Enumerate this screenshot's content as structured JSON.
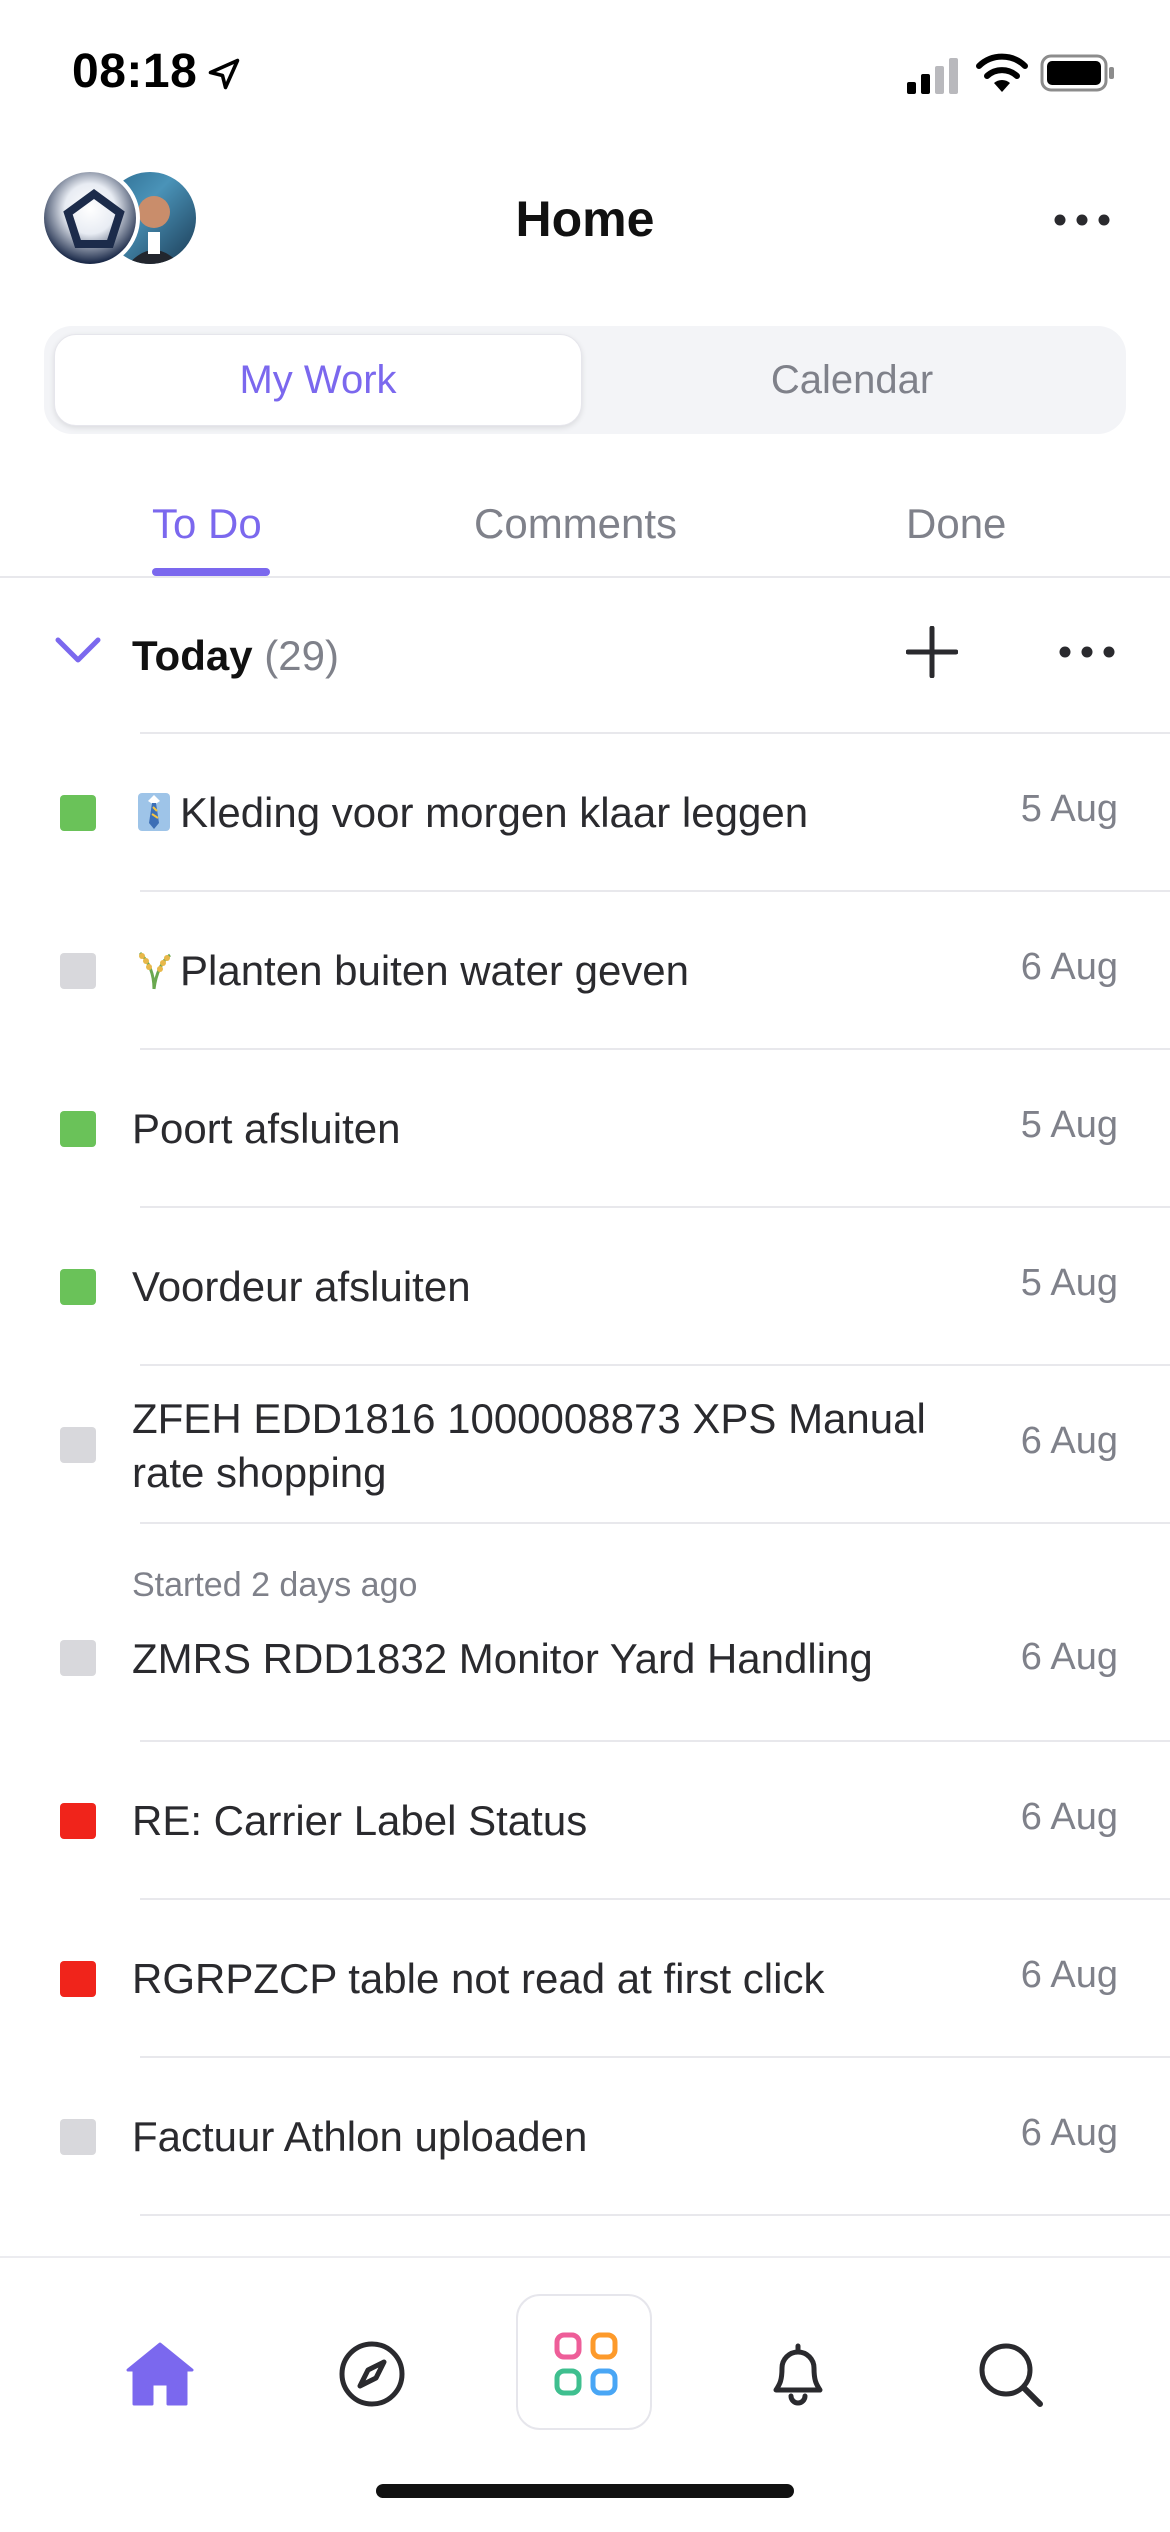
{
  "status_bar": {
    "time": "08:18"
  },
  "header": {
    "title": "Home"
  },
  "segmented": {
    "options": [
      "My Work",
      "Calendar"
    ],
    "selected": "My Work"
  },
  "tabs": {
    "items": [
      "To Do",
      "Comments",
      "Done"
    ],
    "selected": "To Do"
  },
  "group": {
    "title": "Today",
    "count": "(29)"
  },
  "tasks": [
    {
      "name": "Kleding voor morgen klaar leggen",
      "date": "5 Aug",
      "status_color": "#6ac259"
    },
    {
      "name": "Planten buiten water geven",
      "date": "6 Aug",
      "status_color": "#d8d8dc"
    },
    {
      "name": "Poort afsluiten",
      "date": "5 Aug",
      "status_color": "#6ac259"
    },
    {
      "name": "Voordeur afsluiten",
      "date": "5 Aug",
      "status_color": "#6ac259"
    },
    {
      "name": "ZFEH EDD1816 1000008873 XPS Manual rate shopping",
      "date": "6 Aug",
      "status_color": "#d8d8dc"
    },
    {
      "name": "ZMRS RDD1832 Monitor Yard Handling",
      "date": "6 Aug",
      "status_color": "#d8d8dc",
      "meta": "Started 2 days ago"
    },
    {
      "name": "RE: Carrier Label Status",
      "date": "6 Aug",
      "status_color": "#f0241b"
    },
    {
      "name": "RGRPZCP table not read at first click",
      "date": "6 Aug",
      "status_color": "#f0241b"
    },
    {
      "name": "Factuur Athlon uploaden",
      "date": "6 Aug",
      "status_color": "#d8d8dc"
    }
  ],
  "icons": {
    "task_0_emoji": "necktie-shirt-icon",
    "task_1_emoji": "rice-plant-icon",
    "nav": [
      "home-icon",
      "compass-icon",
      "apps-grid-icon",
      "bell-icon",
      "search-icon"
    ]
  },
  "colors": {
    "accent": "#7b68ee",
    "text_muted": "#7f818a",
    "done_green": "#6ac259",
    "urgent_red": "#f0241b",
    "todo_gray": "#d8d8dc"
  }
}
